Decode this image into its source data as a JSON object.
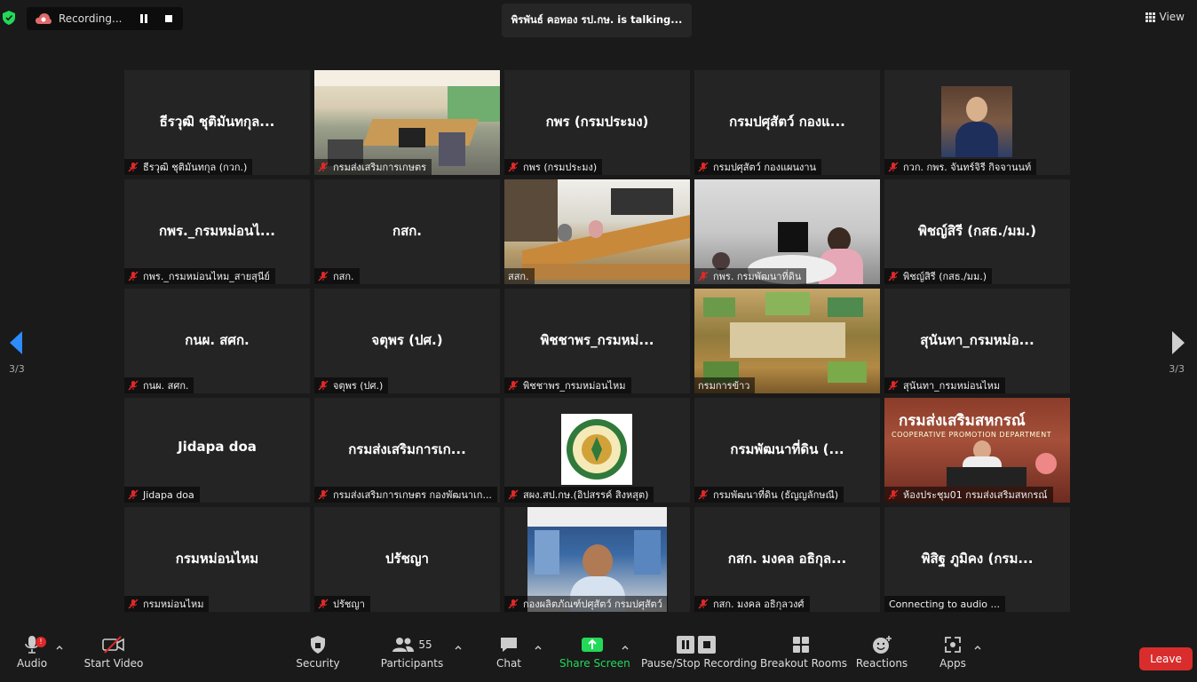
{
  "topbar": {
    "recording_label": "Recording...",
    "talking_text": "พิรพันธ์ คอทอง รป.กษ. is  talking...",
    "view_label": "View"
  },
  "pagination": {
    "left": "3/3",
    "right": "3/3"
  },
  "tiles": [
    {
      "big": "ธีรวุฒิ ชุติมันทกุล...",
      "name": "ธีรวุฒิ ชุติมันทกุล (กวก.)"
    },
    {
      "big": "",
      "name": "กรมส่งเสริมการเกษตร"
    },
    {
      "big": "กพร (กรมประมง)",
      "name": "กพร (กรมประมง)"
    },
    {
      "big": "กรมปศุสัตว์ กองแ...",
      "name": "กรมปศุสัตว์ กองแผนงาน"
    },
    {
      "big": "",
      "name": "กวก. กพร. จันทร์จิรี กิจจานนท์"
    },
    {
      "big": "กพร._กรมหม่อนไ...",
      "name": "กพร._กรมหม่อนไหม_สายสุนีย์"
    },
    {
      "big": "กสก.",
      "name": "กสก."
    },
    {
      "big": "",
      "name": "สสก."
    },
    {
      "big": "",
      "name": "กพร. กรมพัฒนาที่ดิน"
    },
    {
      "big": "พิชญ์สิรี (กสธ./มม.)",
      "name": "พิชญ์สิรี (กสธ./มม.)"
    },
    {
      "big": "กนผ. สศก.",
      "name": "กนผ. สศก."
    },
    {
      "big": "จตุพร (ปศ.)",
      "name": "จตุพร (ปศ.)"
    },
    {
      "big": "พิชชาพร_กรมหม่...",
      "name": "พิชชาพร_กรมหม่อนไหม"
    },
    {
      "big": "",
      "name": "กรมการข้าว"
    },
    {
      "big": "สุนันทา_กรมหม่อ...",
      "name": "สุนันทา_กรมหม่อนไหม"
    },
    {
      "big": "Jidapa doa",
      "name": "Jidapa doa"
    },
    {
      "big": "กรมส่งเสริมการเก...",
      "name": "กรมส่งเสริมการเกษตร กองพัฒนาเก..."
    },
    {
      "big": "",
      "name": "สผง.สป.กษ.(อิปสรรค์ สิงหสุต)"
    },
    {
      "big": "กรมพัฒนาที่ดิน (...",
      "name": "กรมพัฒนาที่ดิน (ธัญญลักษณี)"
    },
    {
      "big": "",
      "name": "ห้องประชุม01 กรมส่งเสริมสหกรณ์"
    },
    {
      "big": "กรมหม่อนไหม",
      "name": "กรมหม่อนไหม"
    },
    {
      "big": "ปรัชญา",
      "name": "ปรัชญา"
    },
    {
      "big": "",
      "name": "กองผลิตภัณฑ์ปศุสัตว์ กรมปศุสัตว์"
    },
    {
      "big": "กสก. มงคล  อธิกุล...",
      "name": "กสก. มงคล  อธิกุลวงศ์"
    },
    {
      "big": "พิสิฐ ภูมิคง (กรม...",
      "name": "Connecting to audio ..."
    }
  ],
  "coop_sign": {
    "title": "กรมส่งเสริมสหกรณ์",
    "subtitle": "COOPERATIVE PROMOTION DEPARTMENT"
  },
  "toolbar": {
    "audio": "Audio",
    "audio_badge": "!",
    "start_video": "Start Video",
    "security": "Security",
    "participants": "Participants",
    "participants_count": "55",
    "chat": "Chat",
    "share_screen": "Share Screen",
    "pause_stop_recording": "Pause/Stop Recording",
    "breakout_rooms": "Breakout Rooms",
    "reactions": "Reactions",
    "apps": "Apps",
    "leave": "Leave"
  },
  "colors": {
    "share_green": "#23d959",
    "leave_red": "#d92d2d",
    "mic_off_red": "#e02828",
    "nav_arrow_blue": "#2d8cff"
  }
}
